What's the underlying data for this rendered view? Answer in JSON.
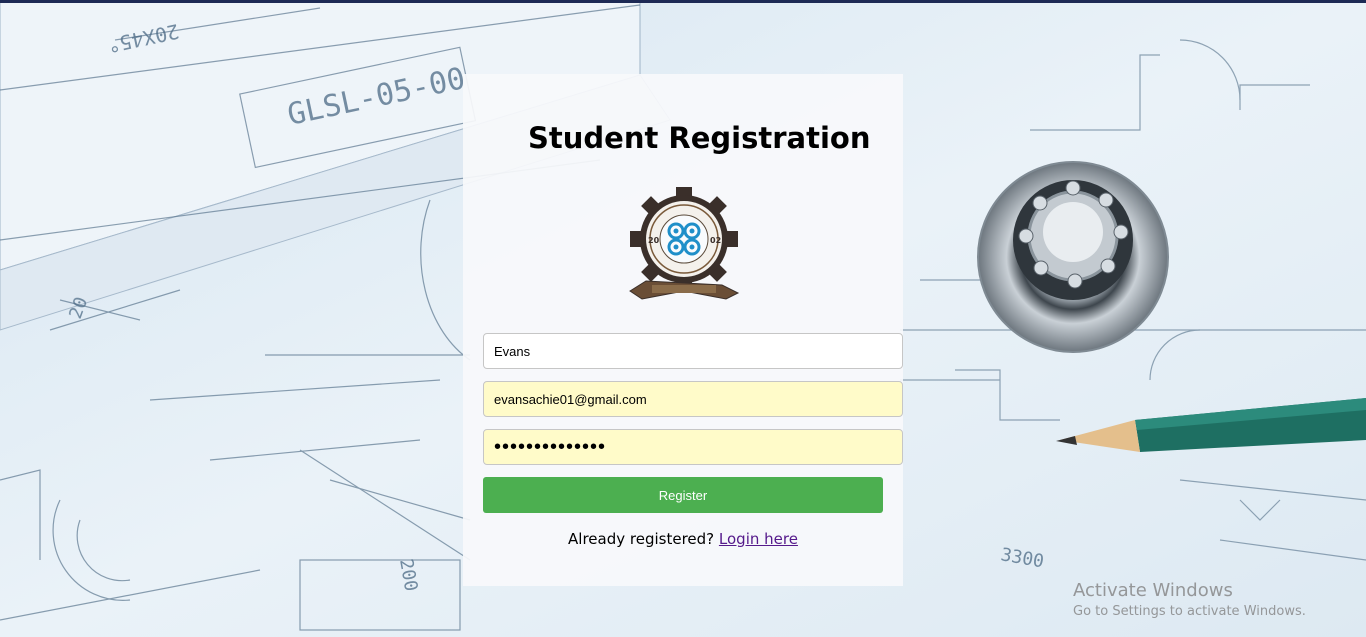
{
  "page": {
    "title": "Student Registration"
  },
  "form": {
    "name_value": "Evans",
    "email_value": "evansachie01@gmail.com",
    "password_value": "evansachie0123",
    "register_label": "Register"
  },
  "footer": {
    "prompt": "Already registered?",
    "login_link": "Login here"
  },
  "logo": {
    "year_left": "20",
    "year_right": "02"
  },
  "watermark": {
    "title": "Activate Windows",
    "subtitle": "Go to Settings to activate Windows."
  },
  "colors": {
    "register_button": "#4caf50",
    "autofill_background": "#fffbc9",
    "link": "#551a8b",
    "top_bar": "#1d2a55"
  }
}
